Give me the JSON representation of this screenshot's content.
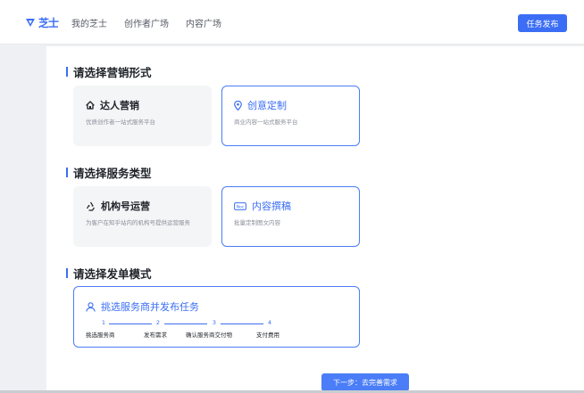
{
  "header": {
    "logo_text": "芝士",
    "nav": [
      "我的芝士",
      "创作者广场",
      "内容广场"
    ],
    "publish_label": "任务发布"
  },
  "sections": {
    "marketing": {
      "title": "请选择营销形式",
      "cards": [
        {
          "title": "达人营销",
          "desc": "优质创作者一站式服务平台",
          "icon": "house-icon",
          "selected": false
        },
        {
          "title": "创意定制",
          "desc": "商业内容一站式服务平台",
          "icon": "location-pin-icon",
          "selected": true
        }
      ]
    },
    "service": {
      "title": "请选择服务类型",
      "cards": [
        {
          "title": "机构号运营",
          "desc": "为客户在知乎站内的机构号提供运营服务",
          "icon": "recycle-icon",
          "selected": false
        },
        {
          "title": "内容撰稿",
          "desc": "批量定制图文内容",
          "icon": "doc-icon",
          "selected": true
        }
      ]
    },
    "mode": {
      "title": "请选择发单模式",
      "card_title": "挑选服务商并发布任务",
      "icon": "user-icon",
      "steps": [
        {
          "num": "1",
          "label": "挑选服务商"
        },
        {
          "num": "2",
          "label": "发布需求"
        },
        {
          "num": "3",
          "label": "确认服务商交付物"
        },
        {
          "num": "4",
          "label": "支付费用"
        }
      ]
    }
  },
  "footer": {
    "next_label": "下一步：去完善需求"
  },
  "colors": {
    "accent": "#3b6ef5",
    "card_bg": "#f4f5f7",
    "page_bg": "#eef0f3"
  }
}
